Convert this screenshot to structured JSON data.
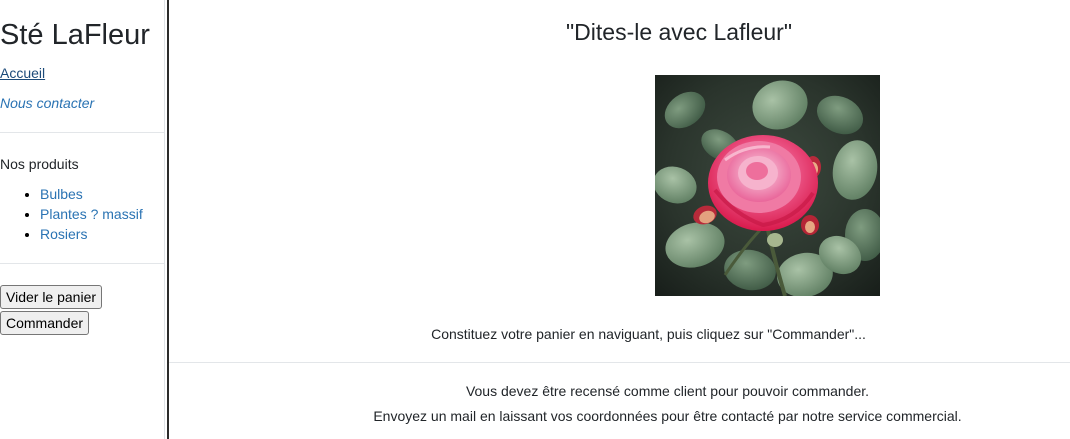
{
  "sidebar": {
    "brand": "Sté LaFleur",
    "nav": {
      "home": "Accueil",
      "contact": "Nous contacter"
    },
    "products_title": "Nos produits",
    "products": [
      {
        "label": "Bulbes"
      },
      {
        "label": "Plantes ? massif"
      },
      {
        "label": "Rosiers"
      }
    ],
    "buttons": {
      "empty_cart": "Vider le panier",
      "order": "Commander"
    }
  },
  "main": {
    "slogan": "\"Dites-le avec Lafleur\"",
    "photo_subject": "pink rose flower",
    "intro": "Constituez votre panier en naviguant, puis cliquez sur \"Commander\"...",
    "notice_line1": "Vous devez être recensé comme client pour pouvoir commander.",
    "notice_line2": "Envoyez un mail en laissant vos coordonnées pour être contacté par notre service commercial."
  },
  "colors": {
    "link_dark": "#1c4a79",
    "link": "#2a73b3",
    "text": "#212529",
    "divider": "#e3e6e9",
    "rose": "#e8325e"
  }
}
